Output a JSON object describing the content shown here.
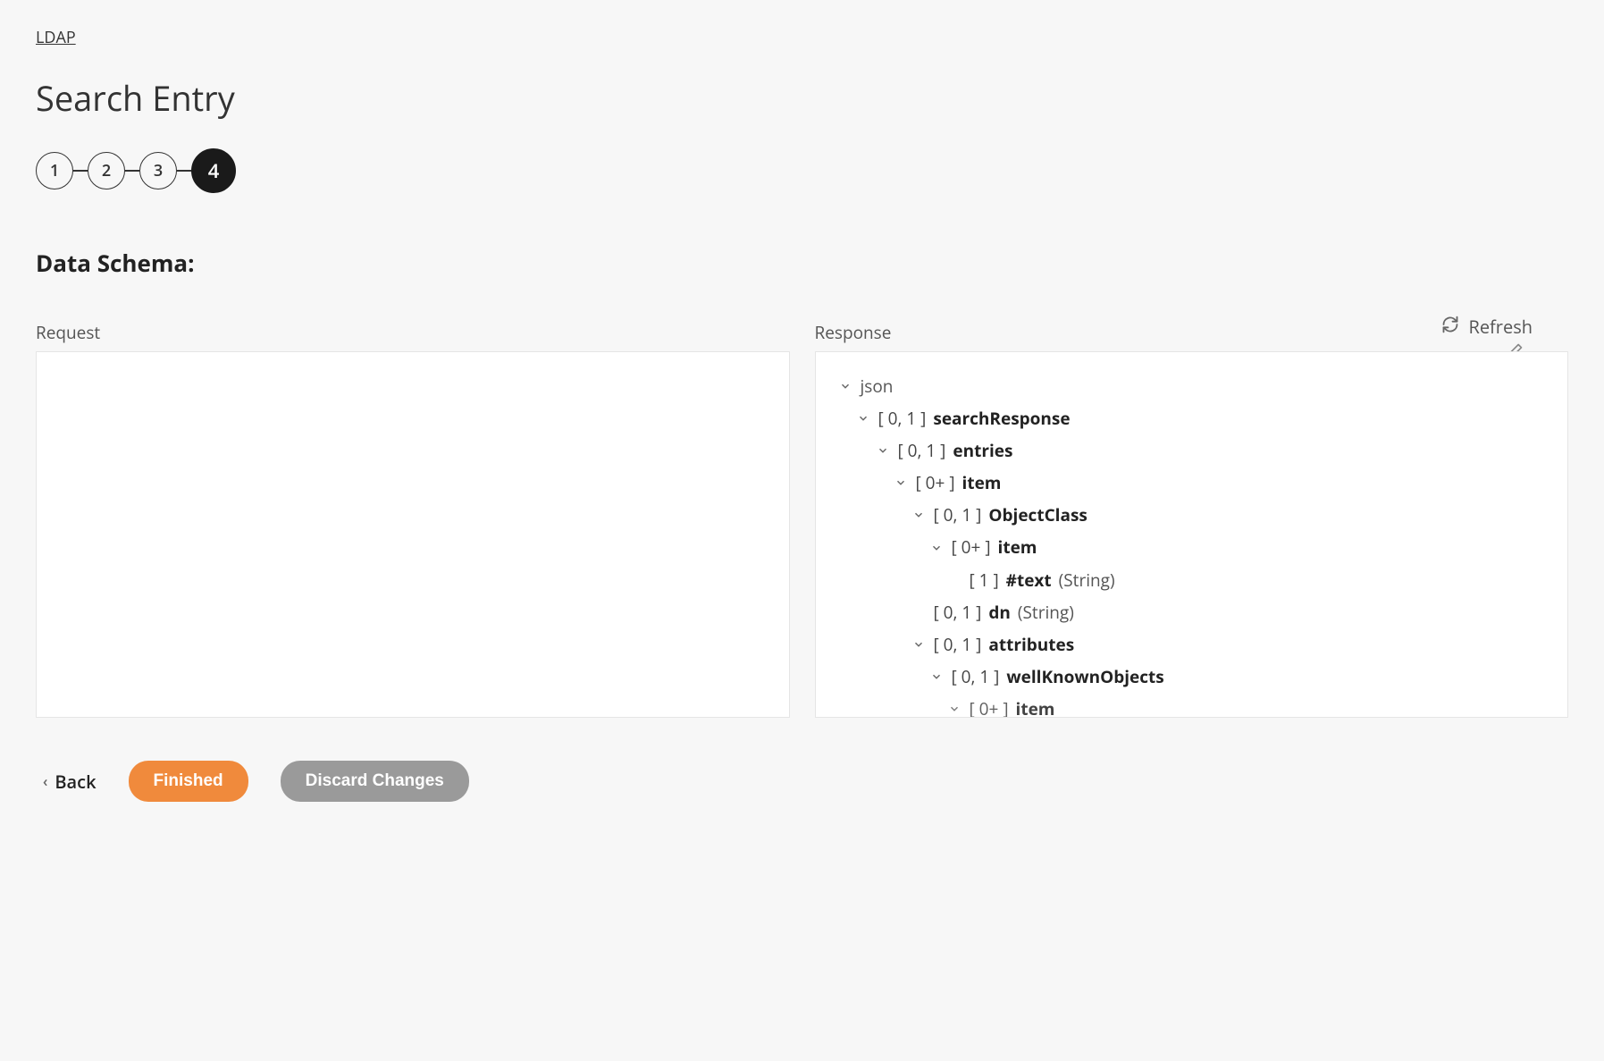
{
  "breadcrumb": {
    "label": "LDAP"
  },
  "page": {
    "title": "Search Entry"
  },
  "stepper": {
    "steps": [
      "1",
      "2",
      "3",
      "4"
    ],
    "activeIndex": 3
  },
  "section": {
    "title": "Data Schema:"
  },
  "labels": {
    "request": "Request",
    "response": "Response",
    "refresh": "Refresh"
  },
  "tree": {
    "root": "json",
    "nodes": {
      "n1": {
        "bracket": "[ 0, 1 ]",
        "name": "searchResponse"
      },
      "n2": {
        "bracket": "[ 0, 1 ]",
        "name": "entries"
      },
      "n3": {
        "bracket": "[ 0+ ]",
        "name": "item"
      },
      "n4": {
        "bracket": "[ 0, 1 ]",
        "name": "ObjectClass"
      },
      "n5": {
        "bracket": "[ 0+ ]",
        "name": "item"
      },
      "n6": {
        "bracket": "[ 1 ]",
        "name": "#text",
        "type": "(String)"
      },
      "n7": {
        "bracket": "[ 0, 1 ]",
        "name": "dn",
        "type": "(String)"
      },
      "n8": {
        "bracket": "[ 0, 1 ]",
        "name": "attributes"
      },
      "n9": {
        "bracket": "[ 0, 1 ]",
        "name": "wellKnownObjects"
      },
      "n10": {
        "bracket": "[ 0+ ]",
        "name": "item"
      }
    }
  },
  "footer": {
    "back": "Back",
    "finished": "Finished",
    "discard": "Discard Changes"
  },
  "colors": {
    "accent": "#f08a3c",
    "stepActive": "#1a1a1a",
    "secondary": "#9a9a9a"
  }
}
